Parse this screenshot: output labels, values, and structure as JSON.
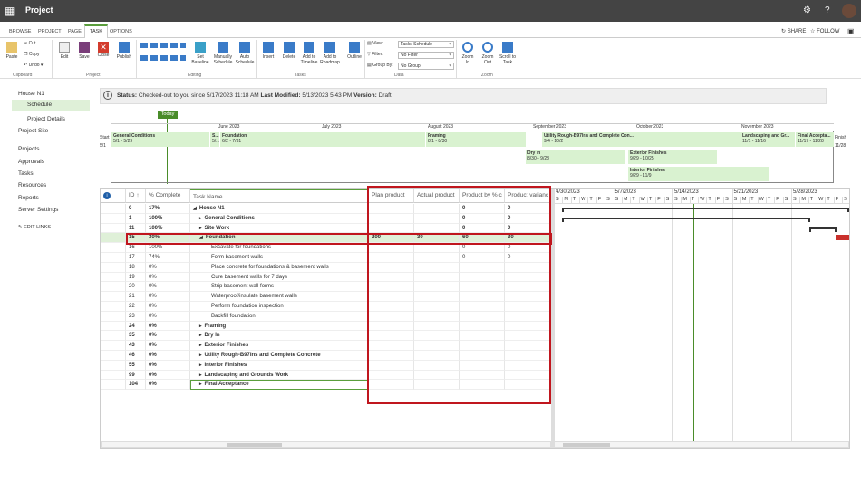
{
  "app": {
    "title": "Project"
  },
  "tabs": [
    "BROWSE",
    "PROJECT",
    "PAGE",
    "TASK",
    "OPTIONS"
  ],
  "share_label": "SHARE",
  "follow_label": "FOLLOW",
  "ribbon": {
    "paste": "Paste",
    "cut": "Cut",
    "copy": "Copy",
    "undo": "Undo",
    "clipboard": "Clipboard",
    "edit": "Edit",
    "save": "Save",
    "close": "Close",
    "publish": "Publish",
    "project": "Project",
    "set_baseline": "Set Baseline",
    "manually_schedule": "Manually Schedule",
    "auto_schedule": "Auto Schedule",
    "editing": "Editing",
    "insert": "Insert",
    "delete": "Delete",
    "add_timeline": "Add to Timeline",
    "add_roadmap": "Add to Roadmap",
    "outline": "Outline",
    "tasks": "Tasks",
    "view": "View:",
    "filter": "Filter:",
    "group_by": "Group By:",
    "view_value": "Tasks Schedule",
    "filter_value": "No Filter",
    "group_value": "No Group",
    "data": "Data",
    "zoom_in": "Zoom In",
    "zoom_out": "Zoom Out",
    "scroll_to_task": "Scroll to Task",
    "zoom": "Zoom"
  },
  "nav": {
    "house": "House N1",
    "schedule": "Schedule",
    "project_details": "Project Details",
    "project_site": "Project Site",
    "projects": "Projects",
    "approvals": "Approvals",
    "tasks": "Tasks",
    "resources": "Resources",
    "reports": "Reports",
    "server_settings": "Server Settings",
    "edit_links": "EDIT LINKS"
  },
  "status": {
    "label": "Status:",
    "text": "Checked-out to you since 5/17/2023 11:18 AM",
    "lm_label": "Last Modified:",
    "lm_text": "5/13/2023 5:43 PM",
    "ver_label": "Version:",
    "ver_text": "Draft"
  },
  "timeline": {
    "today": "Today",
    "start": "Start",
    "start_date": "5/1",
    "finish": "Finish",
    "finish_date": "11/28",
    "months": [
      "June 2023",
      "July 2023",
      "August 2023",
      "September 2023",
      "October 2023",
      "November 2023"
    ],
    "bars": [
      {
        "name": "General Conditions",
        "dates": "5/1 - 5/29"
      },
      {
        "name": "S...",
        "dates": "5/..."
      },
      {
        "name": "Foundation",
        "dates": "6/2 - 7/31"
      },
      {
        "name": "Framing",
        "dates": "8/1 - 8/30"
      },
      {
        "name": "Utility Rough-B97Ins and Complete Con...",
        "dates": "9/4 - 10/2"
      },
      {
        "name": "Landscaping and Gr...",
        "dates": "11/1 - 11/16"
      },
      {
        "name": "Final Accepta...",
        "dates": "11/17 - 11/28"
      },
      {
        "name": "Dry In",
        "dates": "8/30 - 9/28"
      },
      {
        "name": "Exterior Finishes",
        "dates": "9/29 - 10/25"
      },
      {
        "name": "Interior Finishes",
        "dates": "9/29 - 11/9"
      }
    ]
  },
  "grid": {
    "headers": [
      "ID",
      "% Complete",
      "Task Name",
      "Plan product",
      "Actual product",
      "Product by % c",
      "Product varianc"
    ],
    "rows": [
      {
        "id": "0",
        "pct": "17%",
        "name": "House N1",
        "plan": "",
        "actual": "",
        "bypct": "0",
        "var": "0",
        "bold": true,
        "indent": 0,
        "arrow": "◢"
      },
      {
        "id": "1",
        "pct": "100%",
        "name": "General Conditions",
        "plan": "",
        "actual": "",
        "bypct": "0",
        "var": "0",
        "bold": true,
        "indent": 1,
        "arrow": "▸"
      },
      {
        "id": "11",
        "pct": "100%",
        "name": "Site Work",
        "plan": "",
        "actual": "",
        "bypct": "0",
        "var": "0",
        "bold": true,
        "indent": 1,
        "arrow": "▸"
      },
      {
        "id": "15",
        "pct": "30%",
        "name": "Foundation",
        "plan": "200",
        "actual": "30",
        "bypct": "60",
        "var": "30",
        "bold": true,
        "indent": 1,
        "arrow": "◢"
      },
      {
        "id": "16",
        "pct": "100%",
        "name": "Excavate for foundations",
        "plan": "",
        "actual": "",
        "bypct": "0",
        "var": "0",
        "bold": false,
        "indent": 2,
        "arrow": ""
      },
      {
        "id": "17",
        "pct": "74%",
        "name": "Form basement walls",
        "plan": "",
        "actual": "",
        "bypct": "0",
        "var": "0",
        "bold": false,
        "indent": 2,
        "arrow": ""
      },
      {
        "id": "18",
        "pct": "0%",
        "name": "Place concrete for foundations & basement walls",
        "plan": "",
        "actual": "",
        "bypct": "",
        "var": "",
        "bold": false,
        "indent": 2,
        "arrow": ""
      },
      {
        "id": "19",
        "pct": "0%",
        "name": "Cure basement walls for 7 days",
        "plan": "",
        "actual": "",
        "bypct": "",
        "var": "",
        "bold": false,
        "indent": 2,
        "arrow": ""
      },
      {
        "id": "20",
        "pct": "0%",
        "name": "Strip basement wall forms",
        "plan": "",
        "actual": "",
        "bypct": "",
        "var": "",
        "bold": false,
        "indent": 2,
        "arrow": ""
      },
      {
        "id": "21",
        "pct": "0%",
        "name": "Waterproof/insulate basement walls",
        "plan": "",
        "actual": "",
        "bypct": "",
        "var": "",
        "bold": false,
        "indent": 2,
        "arrow": ""
      },
      {
        "id": "22",
        "pct": "0%",
        "name": "Perform foundation inspection",
        "plan": "",
        "actual": "",
        "bypct": "",
        "var": "",
        "bold": false,
        "indent": 2,
        "arrow": ""
      },
      {
        "id": "23",
        "pct": "0%",
        "name": "Backfill foundation",
        "plan": "",
        "actual": "",
        "bypct": "",
        "var": "",
        "bold": false,
        "indent": 2,
        "arrow": ""
      },
      {
        "id": "24",
        "pct": "0%",
        "name": "Framing",
        "plan": "",
        "actual": "",
        "bypct": "",
        "var": "",
        "bold": true,
        "indent": 1,
        "arrow": "▸"
      },
      {
        "id": "35",
        "pct": "0%",
        "name": "Dry In",
        "plan": "",
        "actual": "",
        "bypct": "",
        "var": "",
        "bold": true,
        "indent": 1,
        "arrow": "▸"
      },
      {
        "id": "43",
        "pct": "0%",
        "name": "Exterior Finishes",
        "plan": "",
        "actual": "",
        "bypct": "",
        "var": "",
        "bold": true,
        "indent": 1,
        "arrow": "▸"
      },
      {
        "id": "46",
        "pct": "0%",
        "name": "Utility Rough-B97Ins and Complete Concrete",
        "plan": "",
        "actual": "",
        "bypct": "",
        "var": "",
        "bold": true,
        "indent": 1,
        "arrow": "▸"
      },
      {
        "id": "55",
        "pct": "0%",
        "name": "Interior Finishes",
        "plan": "",
        "actual": "",
        "bypct": "",
        "var": "",
        "bold": true,
        "indent": 1,
        "arrow": "▸"
      },
      {
        "id": "99",
        "pct": "0%",
        "name": "Landscaping and Grounds Work",
        "plan": "",
        "actual": "",
        "bypct": "",
        "var": "",
        "bold": true,
        "indent": 1,
        "arrow": "▸"
      },
      {
        "id": "104",
        "pct": "0%",
        "name": "Final Acceptance",
        "plan": "",
        "actual": "",
        "bypct": "",
        "var": "",
        "bold": true,
        "indent": 1,
        "arrow": "▸"
      }
    ]
  },
  "gantt": {
    "weeks": [
      "4/30/2023",
      "5/7/2023",
      "5/14/2023",
      "5/21/2023",
      "5/28/2023"
    ],
    "days": [
      "S",
      "M",
      "T",
      "W",
      "T",
      "F",
      "S"
    ]
  },
  "colors": {
    "accent": "#5a9e3c",
    "highlight": "#c0161e",
    "bar": "#d9f2d0",
    "barDark": "#c7eabd"
  }
}
